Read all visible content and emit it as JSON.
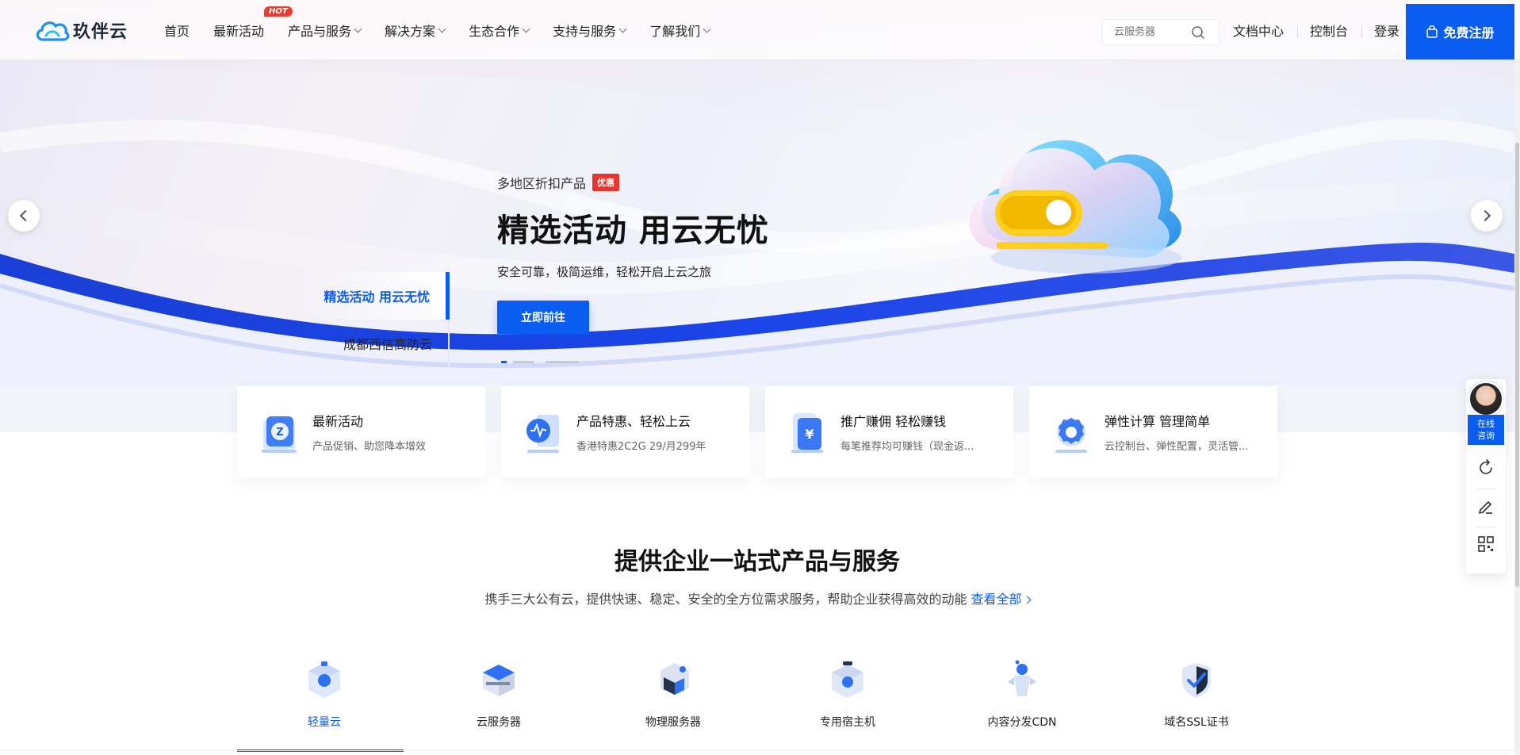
{
  "header": {
    "logo_text": "玖伴云",
    "nav": [
      {
        "label": "首页",
        "dropdown": false
      },
      {
        "label": "最新活动",
        "dropdown": false,
        "badge": "HOT"
      },
      {
        "label": "产品与服务",
        "dropdown": true
      },
      {
        "label": "解决方案",
        "dropdown": true
      },
      {
        "label": "生态合作",
        "dropdown": true
      },
      {
        "label": "支持与服务",
        "dropdown": true
      },
      {
        "label": "了解我们",
        "dropdown": true
      }
    ],
    "search_placeholder": "云服务器",
    "links": {
      "docs": "文档中心",
      "console": "控制台",
      "login": "登录"
    },
    "register_label": "免费注册"
  },
  "hero": {
    "subtitle": "多地区折扣产品",
    "badge": "优惠",
    "title": "精选活动 用云无忧",
    "desc": "安全可靠，极简运维，轻松开启上云之旅",
    "button": "立即前往",
    "tabs": [
      "精选活动 用云无忧",
      "成都西信高防云"
    ],
    "active_tab": 0,
    "slide_count": 3
  },
  "quick_cards": [
    {
      "title": "最新活动",
      "desc": "产品促销、助您降本增效",
      "icon": "gift-badge-icon"
    },
    {
      "title": "产品特惠、轻松上云",
      "desc": "香港特惠2C2G 29/月299年",
      "icon": "shield-chart-icon"
    },
    {
      "title": "推广赚佣 轻松赚钱",
      "desc": "每笔推荐均可赚钱（现金返...",
      "icon": "yen-phone-icon"
    },
    {
      "title": "弹性计算 管理简单",
      "desc": "云控制台、弹性配置，灵活管...",
      "icon": "gear-wrench-icon"
    }
  ],
  "services": {
    "title": "提供企业一站式产品与服务",
    "desc": "携手三大公有云，提供快速、稳定、安全的全方位需求服务，帮助企业获得高效的动能",
    "view_all": "查看全部",
    "tabs": [
      {
        "label": "轻量云",
        "icon": "lightweight-cloud-icon"
      },
      {
        "label": "云服务器",
        "icon": "cloud-server-icon"
      },
      {
        "label": "物理服务器",
        "icon": "physical-server-icon"
      },
      {
        "label": "专用宿主机",
        "icon": "dedicated-host-icon"
      },
      {
        "label": "内容分发CDN",
        "icon": "cdn-icon"
      },
      {
        "label": "域名SSL证书",
        "icon": "ssl-certificate-icon"
      }
    ],
    "active_tab": 0
  },
  "float_bar": {
    "consult_label": "在线\n咨询",
    "icons": [
      "refresh-icon",
      "edit-icon",
      "qrcode-icon"
    ]
  },
  "colors": {
    "brand": "#0b5cf0",
    "hot": "#ef3b2d",
    "promo": "#e8342c"
  }
}
